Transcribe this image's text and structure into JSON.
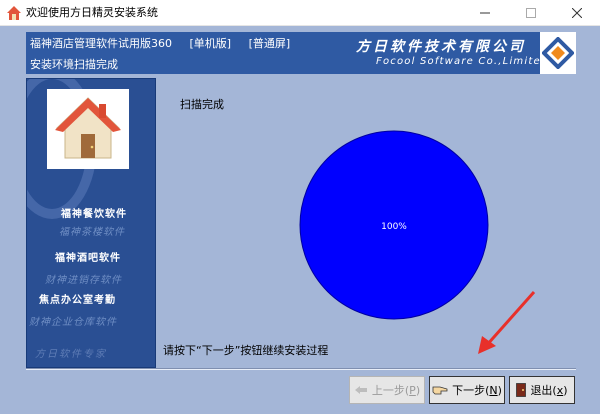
{
  "window": {
    "title": "欢迎使用方日精灵安装系统",
    "minimize_glyph": "—",
    "maximize_glyph": "☐",
    "close_glyph": "✕"
  },
  "banner": {
    "product": "福神酒店管理软件试用版360",
    "mode": "[单机版]",
    "screen": "[普通屏]",
    "status": "安装环境扫描完成",
    "company_cn": "方日软件技术有限公司",
    "company_en": "Focool Software Co.,Limited"
  },
  "sidebar": {
    "products": [
      "福神餐饮软件",
      "福神茶楼软件",
      "福神酒吧软件",
      "财神进销存软件",
      "焦点办公室考勤",
      "财神企业仓库软件"
    ],
    "motto": "方日软件专家"
  },
  "main": {
    "scan_label": "扫描完成",
    "progress": {
      "value": 100,
      "text": "100%"
    },
    "instruction": "请按下“下一步”按钮继续安装过程"
  },
  "buttons": {
    "prev": {
      "label": "上一步(",
      "key": "P",
      "close": ")"
    },
    "next": {
      "label": "下一步(",
      "key": "N",
      "close": ")"
    },
    "exit": {
      "label": "退出(",
      "key": "x",
      "close": ")"
    }
  },
  "colors": {
    "client_bg": "#a4b6d7",
    "banner_bg": "#2f5aa3",
    "pie_fill": "#0000ff",
    "sidebar_bg": "#2a4f93"
  }
}
